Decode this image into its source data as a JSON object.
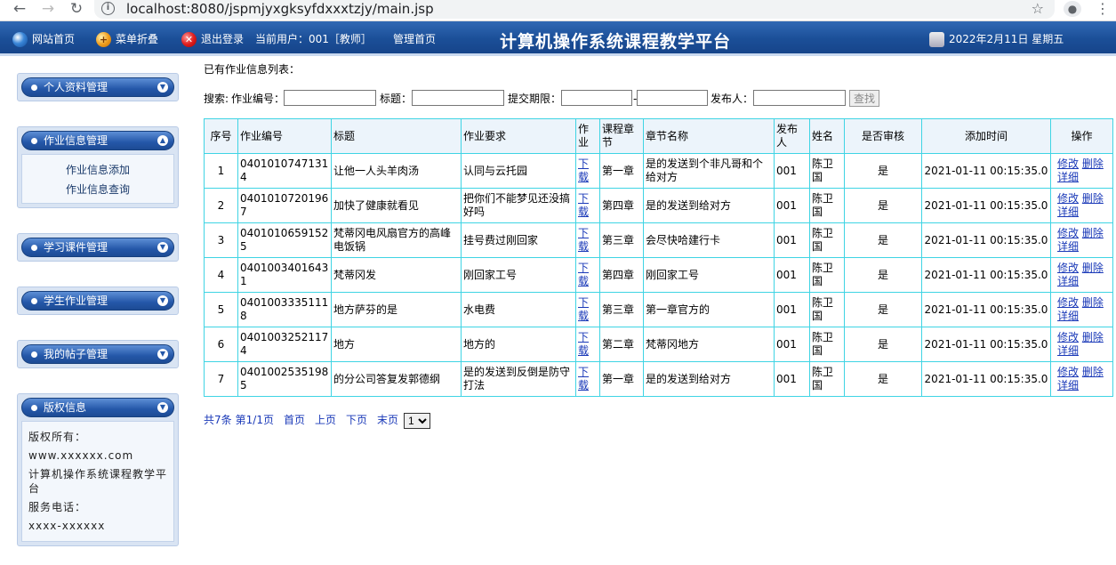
{
  "browser": {
    "url": "localhost:8080/jspmjyxgksyfdxxxtzjy/main.jsp",
    "back": "←",
    "forward": "→",
    "reload": "↻",
    "info": "i",
    "star": "☆",
    "more": "⋮"
  },
  "topbar": {
    "home": "网站首页",
    "collapse": "菜单折叠",
    "logout": "退出登录",
    "user": "当前用户：001［教师］",
    "admin_home": "管理首页",
    "site_title": "计算机操作系统课程教学平台",
    "date": "2022年2月11日 星期五"
  },
  "sidebar": {
    "personal": "个人资料管理",
    "homework": "作业信息管理",
    "homework_add": "作业信息添加",
    "homework_query": "作业信息查询",
    "courseware": "学习课件管理",
    "student_hw": "学生作业管理",
    "posts": "我的帖子管理",
    "copyright": "版权信息",
    "c_owner_label": "版权所有：",
    "c_site": "www.xxxxxx.com",
    "c_name": "计算机操作系统课程教学平台",
    "c_phone_label": "服务电话：",
    "c_phone": "xxxx-xxxxxx"
  },
  "main": {
    "list_title": "已有作业信息列表：",
    "search_label": "搜索:",
    "f_code": "作业编号：",
    "f_title": "标题：",
    "f_deadline": "提交期限：",
    "f_dash": "-",
    "f_publisher": "发布人：",
    "search_btn": "查找"
  },
  "table": {
    "headers": [
      "序号",
      "作业编号",
      "标题",
      "作业要求",
      "作业",
      "课程章节",
      "章节名称",
      "发布人",
      "姓名",
      "是否审核",
      "添加时间",
      "操作"
    ],
    "download": "下载",
    "edit": "修改",
    "delete": "删除",
    "detail": "详细",
    "rows": [
      {
        "no": "1",
        "code": "04010107471314",
        "title": "让他一人头羊肉汤",
        "req": "认同与云托园",
        "chapter": "第一章",
        "chapter_name": "是的发送到个非凡哥和个给对方",
        "publisher": "001",
        "name": "陈卫国",
        "audited": "是",
        "time": "2021-01-11 00:15:35.0"
      },
      {
        "no": "2",
        "code": "04010107201967",
        "title": "加快了健康就看见",
        "req": "把你们不能梦见还没搞好吗",
        "chapter": "第四章",
        "chapter_name": "是的发送到给对方",
        "publisher": "001",
        "name": "陈卫国",
        "audited": "是",
        "time": "2021-01-11 00:15:35.0"
      },
      {
        "no": "3",
        "code": "04010106591525",
        "title": "梵蒂冈电风扇官方的高峰电饭锅",
        "req": "挂号费过刚回家",
        "chapter": "第三章",
        "chapter_name": "会尽快哈建行卡",
        "publisher": "001",
        "name": "陈卫国",
        "audited": "是",
        "time": "2021-01-11 00:15:35.0"
      },
      {
        "no": "4",
        "code": "04010034016431",
        "title": "梵蒂冈发",
        "req": "刚回家工号",
        "chapter": "第四章",
        "chapter_name": "刚回家工号",
        "publisher": "001",
        "name": "陈卫国",
        "audited": "是",
        "time": "2021-01-11 00:15:35.0"
      },
      {
        "no": "5",
        "code": "04010033351118",
        "title": "地方萨芬的是",
        "req": "水电费",
        "chapter": "第三章",
        "chapter_name": "第一章官方的",
        "publisher": "001",
        "name": "陈卫国",
        "audited": "是",
        "time": "2021-01-11 00:15:35.0"
      },
      {
        "no": "6",
        "code": "04010032521174",
        "title": "地方",
        "req": "地方的",
        "chapter": "第二章",
        "chapter_name": "梵蒂冈地方",
        "publisher": "001",
        "name": "陈卫国",
        "audited": "是",
        "time": "2021-01-11 00:15:35.0"
      },
      {
        "no": "7",
        "code": "04010025351985",
        "title": "的分公司答复发郭德纲",
        "req": "是的发送到反倒是防守打法",
        "chapter": "第一章",
        "chapter_name": "是的发送到给对方",
        "publisher": "001",
        "name": "陈卫国",
        "audited": "是",
        "time": "2021-01-11 00:15:35.0"
      }
    ]
  },
  "pager": {
    "total": "共7条",
    "page": "第1/1页",
    "first": "首页",
    "prev": "上页",
    "next": "下页",
    "last": "末页",
    "selected": "1"
  },
  "icons": {
    "home": "globe-icon",
    "collapse": "plus-icon",
    "logout": "x-icon",
    "date": "calendar-icon",
    "chevron": "chevron-icon"
  },
  "colors": {
    "topbar": "#1b4f98",
    "table_border": "#3fd4e4",
    "link": "#1a39b8"
  }
}
